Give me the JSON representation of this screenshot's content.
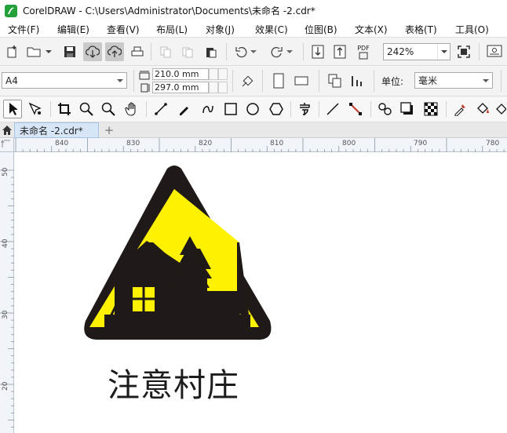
{
  "window": {
    "title": "CorelDRAW - C:\\Users\\Administrator\\Documents\\未命名 -2.cdr*"
  },
  "menu": [
    {
      "label": "文件(F)"
    },
    {
      "label": "编辑(E)"
    },
    {
      "label": "查看(V)"
    },
    {
      "label": "布局(L)"
    },
    {
      "label": "对象(J)"
    },
    {
      "label": "效果(C)"
    },
    {
      "label": "位图(B)"
    },
    {
      "label": "文本(X)"
    },
    {
      "label": "表格(T)"
    },
    {
      "label": "工具(O)"
    }
  ],
  "standard_toolbar": {
    "zoom_value": "242%",
    "pdf_label": "PDF"
  },
  "property_bar": {
    "page_size": "A4",
    "width": "210.0 mm",
    "height": "297.0 mm",
    "units_label": "单位:",
    "units_value": "毫米"
  },
  "document_tabs": [
    {
      "label": "未命名 -2.cdr*"
    }
  ],
  "ruler": {
    "horizontal": [
      "840",
      "830",
      "820",
      "810",
      "800",
      "790",
      "780"
    ],
    "vertical": [
      "50",
      "40",
      "30",
      "20"
    ]
  },
  "canvas": {
    "caption": "注意村庄",
    "sign_colors": {
      "border": "#1f1a17",
      "fill": "#fff200"
    }
  },
  "icons": [
    "new-document-icon",
    "open-folder-icon",
    "save-icon",
    "cloud-download-icon",
    "cloud-upload-icon",
    "print-icon",
    "copy-icon",
    "paste-icon",
    "undo-icon",
    "redo-icon",
    "import-icon",
    "export-icon",
    "pdf-icon",
    "full-screen-icon",
    "options-icon"
  ]
}
